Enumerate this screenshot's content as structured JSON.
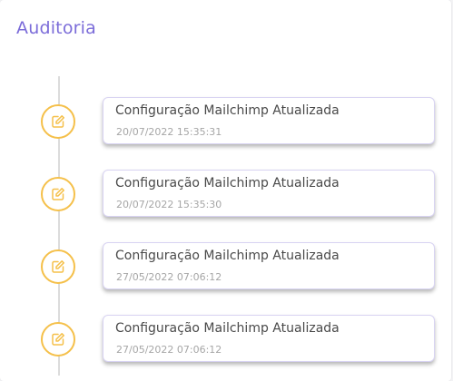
{
  "header": {
    "title": "Auditoria"
  },
  "colors": {
    "accent": "#7b6cd9",
    "marker": "#f5c04a"
  },
  "timeline": {
    "items": [
      {
        "icon": "edit-icon",
        "title": "Configuração Mailchimp Atualizada",
        "timestamp": "20/07/2022 15:35:31"
      },
      {
        "icon": "edit-icon",
        "title": "Configuração Mailchimp Atualizada",
        "timestamp": "20/07/2022 15:35:30"
      },
      {
        "icon": "edit-icon",
        "title": "Configuração Mailchimp Atualizada",
        "timestamp": "27/05/2022 07:06:12"
      },
      {
        "icon": "edit-icon",
        "title": "Configuração Mailchimp Atualizada",
        "timestamp": "27/05/2022 07:06:12"
      }
    ]
  }
}
